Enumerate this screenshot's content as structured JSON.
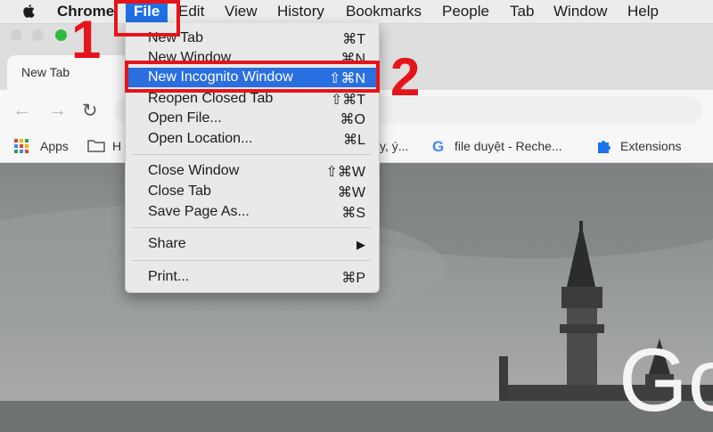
{
  "menubar": {
    "app_name": "Chrome",
    "items": [
      "File",
      "Edit",
      "View",
      "History",
      "Bookmarks",
      "People",
      "Tab",
      "Window",
      "Help"
    ]
  },
  "browser": {
    "tab_title": "New Tab",
    "bookmarks": [
      {
        "label": "Apps",
        "icon": "apps-grid-icon"
      },
      {
        "label": "H",
        "icon": "folder-icon"
      },
      {
        "label": "y, ý...",
        "icon": ""
      },
      {
        "label": "file duyệt - Reche...",
        "icon": "google-icon"
      },
      {
        "label": "Extensions",
        "icon": "puzzle-icon"
      }
    ]
  },
  "file_menu": {
    "groups": [
      [
        {
          "label": "New Tab",
          "shortcut": "⌘T"
        },
        {
          "label": "New Window",
          "shortcut": "⌘N"
        },
        {
          "label": "New Incognito Window",
          "shortcut": "⇧⌘N",
          "highlighted": true
        },
        {
          "label": "Reopen Closed Tab",
          "shortcut": "⇧⌘T"
        },
        {
          "label": "Open File...",
          "shortcut": "⌘O"
        },
        {
          "label": "Open Location...",
          "shortcut": "⌘L"
        }
      ],
      [
        {
          "label": "Close Window",
          "shortcut": "⇧⌘W"
        },
        {
          "label": "Close Tab",
          "shortcut": "⌘W"
        },
        {
          "label": "Save Page As...",
          "shortcut": "⌘S"
        }
      ],
      [
        {
          "label": "Share",
          "shortcut": "▶"
        }
      ],
      [
        {
          "label": "Print...",
          "shortcut": "⌘P"
        }
      ]
    ]
  },
  "annotations": {
    "step1": "1",
    "step2": "2"
  },
  "page_logo_text": "Go",
  "colors": {
    "highlight": "#2a6fe0",
    "annotation_red": "#e5141b",
    "menu_bg": "#e9e9e9"
  }
}
